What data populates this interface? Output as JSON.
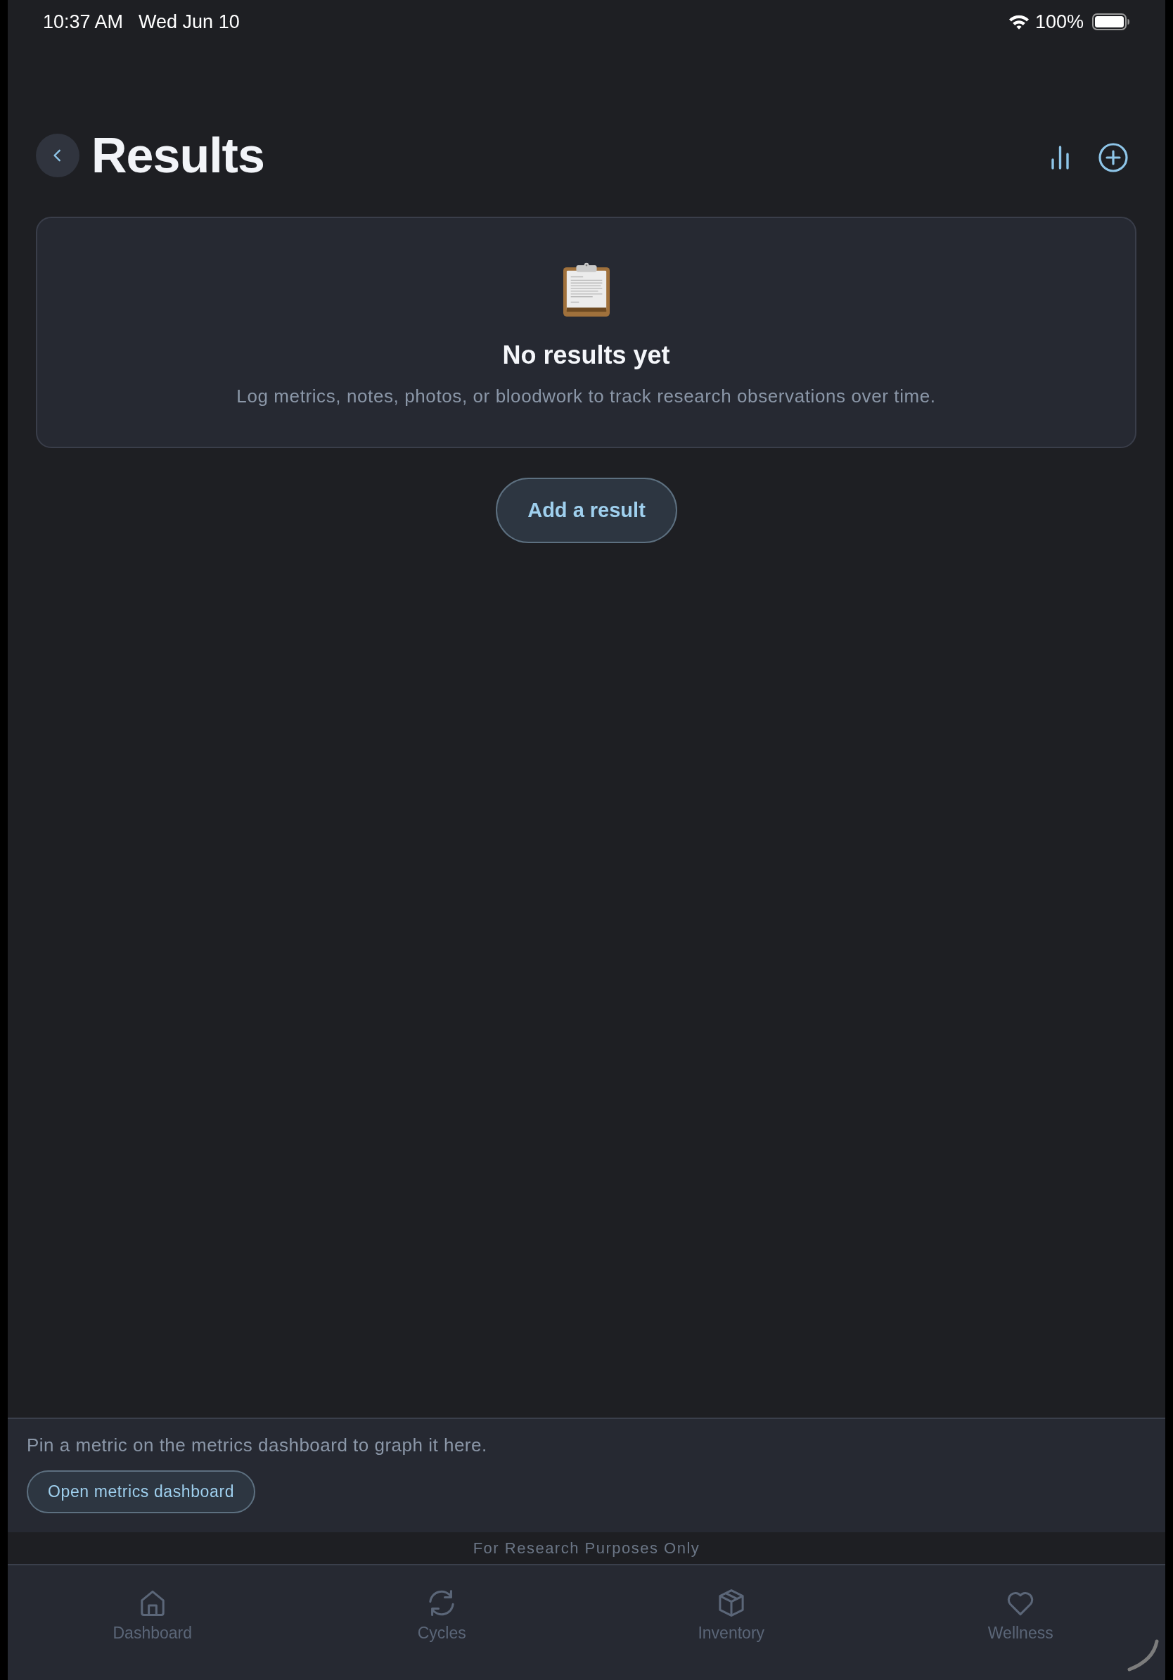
{
  "status_bar": {
    "time": "10:37 AM",
    "date": "Wed Jun 10",
    "battery": "100%"
  },
  "header": {
    "title": "Results"
  },
  "empty_state": {
    "title": "No results yet",
    "message": "Log metrics, notes, photos, or bloodwork to track research observations over time.",
    "button": "Add a result"
  },
  "metrics_panel": {
    "message": "Pin a metric on the metrics dashboard to graph it here.",
    "button": "Open metrics dashboard"
  },
  "footer_note": "For Research Purposes Only",
  "tab_bar": [
    {
      "label": "Dashboard",
      "selected": false
    },
    {
      "label": "Cycles",
      "selected": false
    },
    {
      "label": "Inventory",
      "selected": false
    },
    {
      "label": "Wellness",
      "selected": false
    }
  ]
}
